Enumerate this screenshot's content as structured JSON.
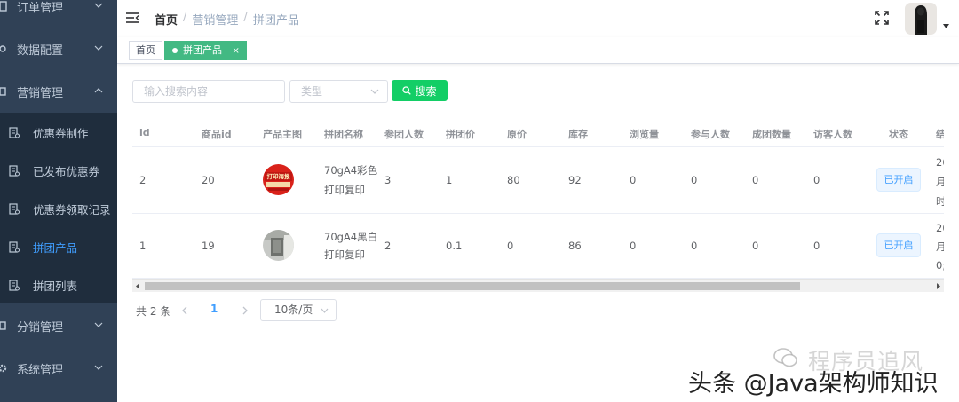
{
  "sidebar": {
    "top_items": [
      {
        "label": "订单管理"
      },
      {
        "label": "数据配置"
      },
      {
        "label": "营销管理"
      }
    ],
    "sub_items": [
      {
        "label": "优惠券制作"
      },
      {
        "label": "已发布优惠券"
      },
      {
        "label": "优惠券领取记录"
      },
      {
        "label": "拼团产品"
      },
      {
        "label": "拼团列表"
      }
    ],
    "bottom_items": [
      {
        "label": "分销管理"
      },
      {
        "label": "系统管理"
      }
    ]
  },
  "navbar": {
    "breadcrumb": [
      "首页",
      "营销管理",
      "拼团产品"
    ],
    "separator": "/"
  },
  "tags": {
    "home": "首页",
    "active": "拼团产品",
    "close": "×"
  },
  "filters": {
    "search_placeholder": "输入搜索内容",
    "type_placeholder": "类型",
    "search_button": "搜索"
  },
  "table": {
    "columns": [
      "id",
      "商品id",
      "产品主图",
      "拼团名称",
      "参团人数",
      "拼团价",
      "原价",
      "库存",
      "浏览量",
      "参与人数",
      "成团数量",
      "访客人数",
      "状态",
      "结"
    ],
    "rows": [
      {
        "id": "2",
        "goods_id": "20",
        "image": "红色打印海报",
        "image_text": "打印海报",
        "name_line1": "70gA4彩色",
        "name_line2": "打印复印",
        "group_size": "3",
        "group_price": "1",
        "original_price": "80",
        "stock": "92",
        "views": "0",
        "participants": "0",
        "groups_formed": "0",
        "visitors": "0",
        "status": "已开启",
        "end_clip": [
          "20",
          "月",
          "时"
        ]
      },
      {
        "id": "1",
        "goods_id": "19",
        "image": "打印机照片",
        "name_line1": "70gA4黑白",
        "name_line2": "打印复印",
        "group_size": "2",
        "group_price": "0.1",
        "original_price": "0",
        "stock": "86",
        "views": "0",
        "participants": "0",
        "groups_formed": "0",
        "visitors": "0",
        "status": "已开启",
        "end_clip": [
          "20",
          "月",
          "0;"
        ]
      }
    ]
  },
  "pagination": {
    "total": "共 2 条",
    "current_page": "1",
    "page_size": "10条/页"
  },
  "watermarks": {
    "wechat": "程序员追风",
    "toutiao": "头条 @Java架构师知识"
  },
  "colors": {
    "sidebar_bg": "#304156",
    "submenu_bg": "#1f2d3d",
    "active_menu": "#409eff",
    "tag_active": "#42b983",
    "search_button": "#13ce66"
  }
}
